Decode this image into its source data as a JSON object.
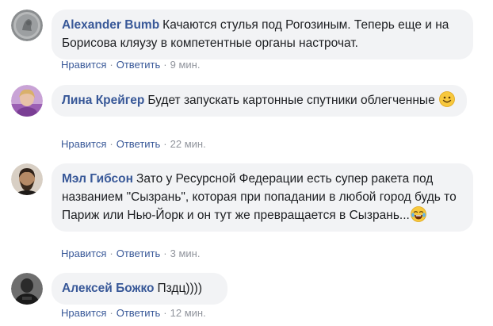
{
  "comments": [
    {
      "author": "Alexander Bumb",
      "text": "Качаются стулья под Рогозиным. Теперь еще и на Борисова кляузу в компетентные органы настрочат.",
      "like": "Нравится",
      "reply": "Ответить",
      "time": "9 мин.",
      "separator": "·"
    },
    {
      "author": "Лина Крейгер",
      "text": "Будет запускать картонные спутники облегченные",
      "like": "Нравится",
      "reply": "Ответить",
      "time": "22 мин.",
      "separator": "·",
      "emoji": "smiling-face-emoji"
    },
    {
      "author": "Мэл Гибсон",
      "text": "Зато у Ресурсной Федерации есть супер ракета под названием \"Сызрань\", которая при попадании в любой город будь то Париж или Нью-Йорк и он тут же превращается в Сызрань...",
      "like": "Нравится",
      "reply": "Ответить",
      "time": "3 мин.",
      "separator": "·",
      "emoji": "tears-of-joy-emoji"
    },
    {
      "author": "Алексей Божко",
      "text": "Пздц))))",
      "like": "Нравится",
      "reply": "Ответить",
      "time": "12 мин.",
      "separator": "·"
    }
  ],
  "colors": {
    "author": "#385898",
    "bubble": "#f2f3f5",
    "meta": "#90949c"
  }
}
